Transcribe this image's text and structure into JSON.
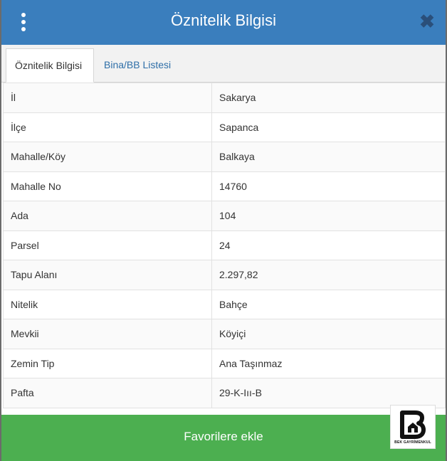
{
  "header": {
    "title": "Öznitelik Bilgisi",
    "menu_icon": "more-vertical-icon",
    "close_icon": "close-icon",
    "close_glyph": "✖"
  },
  "tabs": [
    {
      "label": "Öznitelik Bilgisi",
      "active": true
    },
    {
      "label": "Bina/BB Listesi",
      "active": false
    }
  ],
  "attributes": [
    {
      "key": "İl",
      "value": "Sakarya"
    },
    {
      "key": "İlçe",
      "value": "Sapanca"
    },
    {
      "key": "Mahalle/Köy",
      "value": "Balkaya"
    },
    {
      "key": "Mahalle No",
      "value": "14760"
    },
    {
      "key": "Ada",
      "value": "104"
    },
    {
      "key": "Parsel",
      "value": "24"
    },
    {
      "key": "Tapu Alanı",
      "value": "2.297,82"
    },
    {
      "key": "Nitelik",
      "value": "Bahçe"
    },
    {
      "key": "Mevkii",
      "value": "Köyiçi"
    },
    {
      "key": "Zemin Tip",
      "value": "Ana Taşınmaz"
    },
    {
      "key": "Pafta",
      "value": "29-K-Iıı-B"
    }
  ],
  "favorite_button": {
    "label": "Favorilere ekle"
  },
  "watermark_logo": {
    "caption": "BEK GAYRİMENKUL"
  },
  "colors": {
    "header": "#3a7ebd",
    "favorite": "#4caf50",
    "tab_inactive_text": "#2f6fa8"
  }
}
